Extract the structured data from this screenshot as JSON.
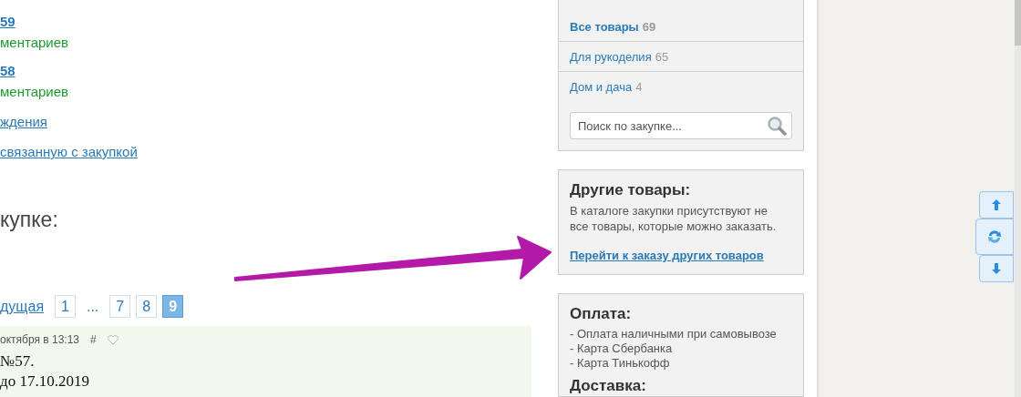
{
  "content": {
    "links": [
      {
        "kind": "number",
        "text": "59"
      },
      {
        "kind": "comments",
        "text": "ментариев"
      },
      {
        "kind": "number",
        "text": "58"
      },
      {
        "kind": "comments",
        "text": "ментариев"
      },
      {
        "kind": "link",
        "text": "ждения"
      },
      {
        "kind": "link",
        "text": "связанную с закупкой"
      }
    ],
    "heading": "купке:",
    "pagination": {
      "prev": "дущая",
      "pages": [
        {
          "label": "1",
          "selected": false
        },
        {
          "label": "...",
          "selected": false,
          "kind": "ellipsis"
        },
        {
          "label": "7",
          "selected": false
        },
        {
          "label": "8",
          "selected": false
        },
        {
          "label": "9",
          "selected": true
        }
      ]
    },
    "post": {
      "date": "октября в 13:13",
      "anchor": "#",
      "lines": [
        "№57.",
        "до 17.10.2019"
      ]
    }
  },
  "sidebar": {
    "catalog": {
      "items": [
        {
          "label": "Все товары",
          "count": "69",
          "selected": true
        },
        {
          "label": "Для рукоделия",
          "count": "65",
          "selected": false
        },
        {
          "label": "Дом и дача",
          "count": "4",
          "selected": false
        }
      ],
      "search": {
        "placeholder": "Поиск по закупке..."
      }
    },
    "other": {
      "title": "Другие товары:",
      "text": "В каталоге закупки присутствуют не все товары, которые можно заказать.",
      "link": "Перейти к заказу других товаров"
    },
    "payment": {
      "title": "Оплата:",
      "lines": [
        "- Оплата наличными при самовывозе",
        "- Карта Сбербанка",
        "- Карта Тинькофф"
      ]
    },
    "delivery": {
      "title": "Доставка:"
    }
  }
}
